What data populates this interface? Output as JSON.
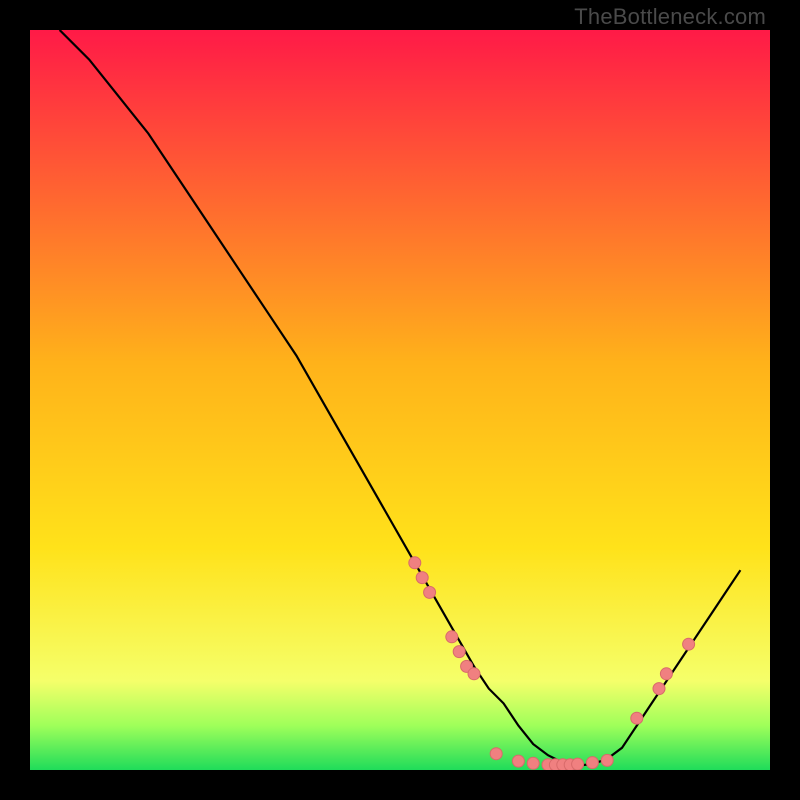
{
  "watermark": "TheBottleneck.com",
  "colors": {
    "grad_top": "#ff1a47",
    "grad_mid": "#ffd21a",
    "grad_low": "#f5ff6a",
    "grad_green": "#1fdc5a",
    "curve": "#000000",
    "marker_fill": "#f08080",
    "marker_stroke": "#d86a6a",
    "frame_bg": "#000000"
  },
  "chart_data": {
    "type": "line",
    "title": "",
    "xlabel": "",
    "ylabel": "",
    "xlim": [
      0,
      100
    ],
    "ylim": [
      0,
      100
    ],
    "series": [
      {
        "name": "curve",
        "x": [
          4,
          8,
          12,
          16,
          20,
          24,
          28,
          32,
          36,
          40,
          44,
          48,
          52,
          56,
          60,
          62,
          64,
          66,
          68,
          70,
          72,
          74,
          76,
          78,
          80,
          82,
          84,
          86,
          88,
          90,
          92,
          94,
          96
        ],
        "y": [
          100,
          96,
          91,
          86,
          80,
          74,
          68,
          62,
          56,
          49,
          42,
          35,
          28,
          21,
          14,
          11,
          9,
          6,
          3.5,
          2,
          1,
          0.6,
          0.8,
          1.5,
          3,
          6,
          9,
          12,
          15,
          18,
          21,
          24,
          27
        ]
      }
    ],
    "markers": [
      {
        "x": 52,
        "y": 28
      },
      {
        "x": 53,
        "y": 26
      },
      {
        "x": 54,
        "y": 24
      },
      {
        "x": 57,
        "y": 18
      },
      {
        "x": 58,
        "y": 16
      },
      {
        "x": 59,
        "y": 14
      },
      {
        "x": 60,
        "y": 13
      },
      {
        "x": 63,
        "y": 2.2
      },
      {
        "x": 66,
        "y": 1.2
      },
      {
        "x": 68,
        "y": 0.9
      },
      {
        "x": 70,
        "y": 0.7
      },
      {
        "x": 71,
        "y": 0.7
      },
      {
        "x": 72,
        "y": 0.7
      },
      {
        "x": 73,
        "y": 0.7
      },
      {
        "x": 74,
        "y": 0.8
      },
      {
        "x": 76,
        "y": 1.0
      },
      {
        "x": 78,
        "y": 1.3
      },
      {
        "x": 82,
        "y": 7
      },
      {
        "x": 85,
        "y": 11
      },
      {
        "x": 86,
        "y": 13
      },
      {
        "x": 89,
        "y": 17
      }
    ],
    "gradient_stops": [
      {
        "offset": 0,
        "color": "#ff1a47"
      },
      {
        "offset": 45,
        "color": "#ffb21a"
      },
      {
        "offset": 70,
        "color": "#ffe21a"
      },
      {
        "offset": 88,
        "color": "#f5ff6a"
      },
      {
        "offset": 94,
        "color": "#9fff5a"
      },
      {
        "offset": 100,
        "color": "#1fdc5a"
      }
    ]
  }
}
